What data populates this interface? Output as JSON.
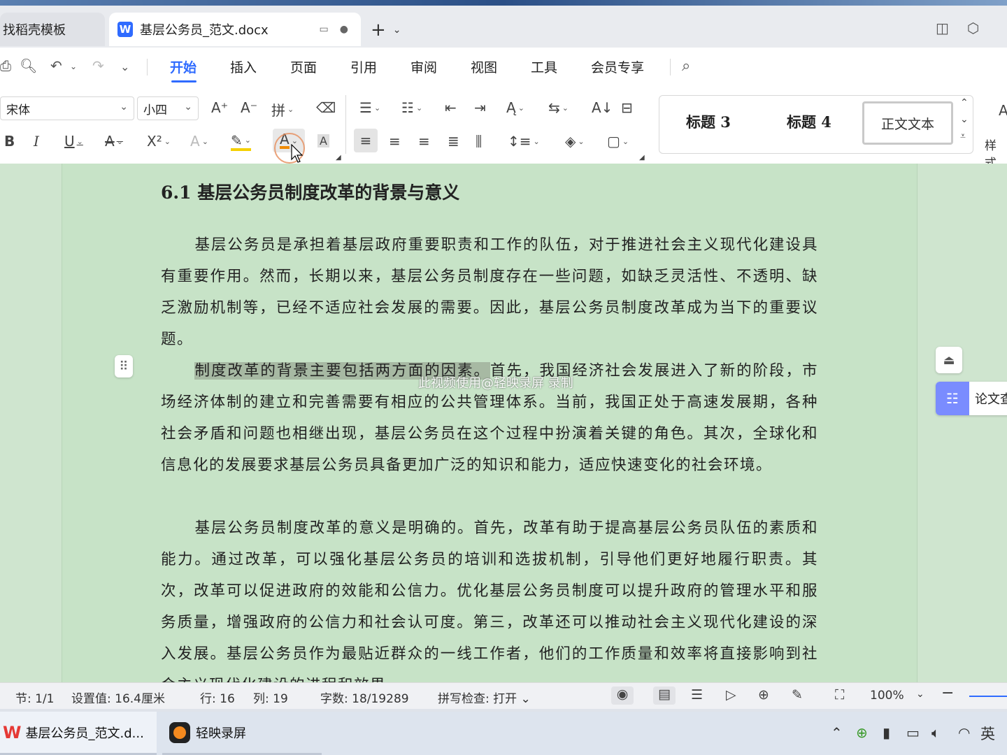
{
  "tabs": {
    "inactive_label": "找稻壳模板",
    "active_label": "基层公务员_范文.docx",
    "app_badge": "W"
  },
  "menu": {
    "items": [
      "开始",
      "插入",
      "页面",
      "引用",
      "审阅",
      "视图",
      "工具",
      "会员专享"
    ],
    "active_index": 0
  },
  "ribbon": {
    "font_name": "宋体",
    "font_size": "小四",
    "styles": [
      "标题 3",
      "标题 4",
      "正文文本"
    ],
    "style_more_label": "样式"
  },
  "document": {
    "heading": "6.1  基层公务员制度改革的背景与意义",
    "para1": "基层公务员是承担着基层政府重要职责和工作的队伍，对于推进社会主义现代化建设具有重要作用。然而，长期以来，基层公务员制度存在一些问题，如缺乏灵活性、不透明、缺乏激励机制等，已经不适应社会发展的需要。因此，基层公务员制度改革成为当下的重要议题。",
    "para2_selected": "制度改革的背景主要包括两方面的因素。",
    "para2_rest": "首先，我国经济社会发展进入了新的阶段，市场经济体制的建立和完善需要有相应的公共管理体系。当前，我国正处于高速发展期，各种社会矛盾和问题也相继出现，基层公务员在这个过程中扮演着关键的角色。其次，全球化和信息化的发展要求基层公务员具备更加广泛的知识和能力，适应快速变化的社会环境。",
    "para3": "基层公务员制度改革的意义是明确的。首先，改革有助于提高基层公务员队伍的素质和能力。通过改革，可以强化基层公务员的培训和选拔机制，引导他们更好地履行职责。其次，改革可以促进政府的效能和公信力。优化基层公务员制度可以提升政府的管理水平和服务质量，增强政府的公信力和社会认可度。第三，改革还可以推动社会主义现代化建设的深入发展。基层公务员作为最贴近群众的一线工作者，他们的工作质量和效率将直接影响到社会主义现代化建设的进程和效果。",
    "watermark": "此视频使用@轻映录屏 录制"
  },
  "side_panel": {
    "paper_check_label": "论文查"
  },
  "status": {
    "section": "节: 1/1",
    "setting": "设置值: 16.4厘米",
    "row": "行: 16",
    "col": "列: 19",
    "wordcount": "字数: 18/19289",
    "spellcheck": "拼写检查: 打开",
    "zoom": "100%"
  },
  "taskbar": {
    "wps_label": "基层公务员_范文.d...",
    "recorder_label": "轻映录屏",
    "ime": "英"
  },
  "colors": {
    "accent": "#2f6bff",
    "doc_bg": "#c7e3c7",
    "selection": "#a7b9a3"
  }
}
